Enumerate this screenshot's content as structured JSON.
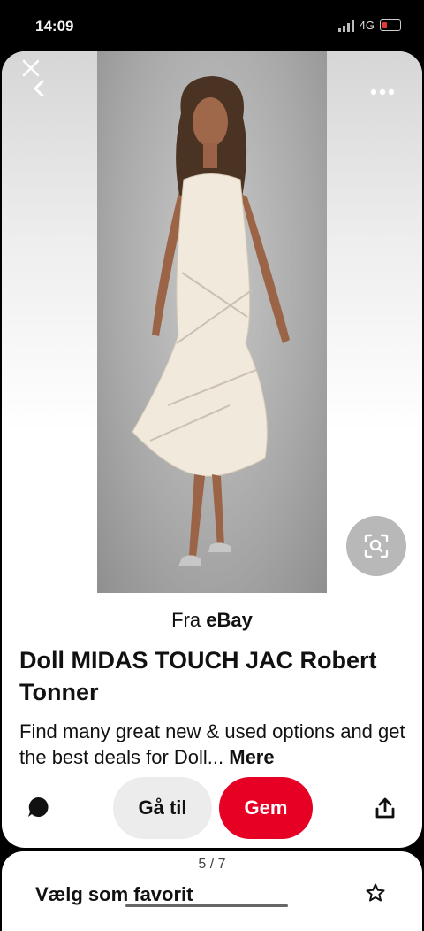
{
  "status_bar": {
    "time": "14:09",
    "network": "4G"
  },
  "pin": {
    "image_alt": "Doll in champagne sequin dress",
    "source_prefix": "Fra",
    "source_name": "eBay",
    "title": "Doll MIDAS TOUCH JAC Robert Tonner",
    "description": "Find many great new & used options and get the best deals for Doll...",
    "more_label": "Mere"
  },
  "actions": {
    "goto_label": "Gå til",
    "save_label": "Gem"
  },
  "sheet": {
    "page_indicator": "5 / 7",
    "favorite_label": "Vælg som favorit"
  },
  "icons": {
    "close": "close-icon",
    "back": "chevron-left-icon",
    "more": "more-horizontal-icon",
    "lens": "visual-search-icon",
    "comment": "comment-icon",
    "share": "share-icon",
    "star": "star-icon"
  },
  "colors": {
    "save_button": "#e60023",
    "goto_button": "#ececec",
    "background": "#000000"
  }
}
